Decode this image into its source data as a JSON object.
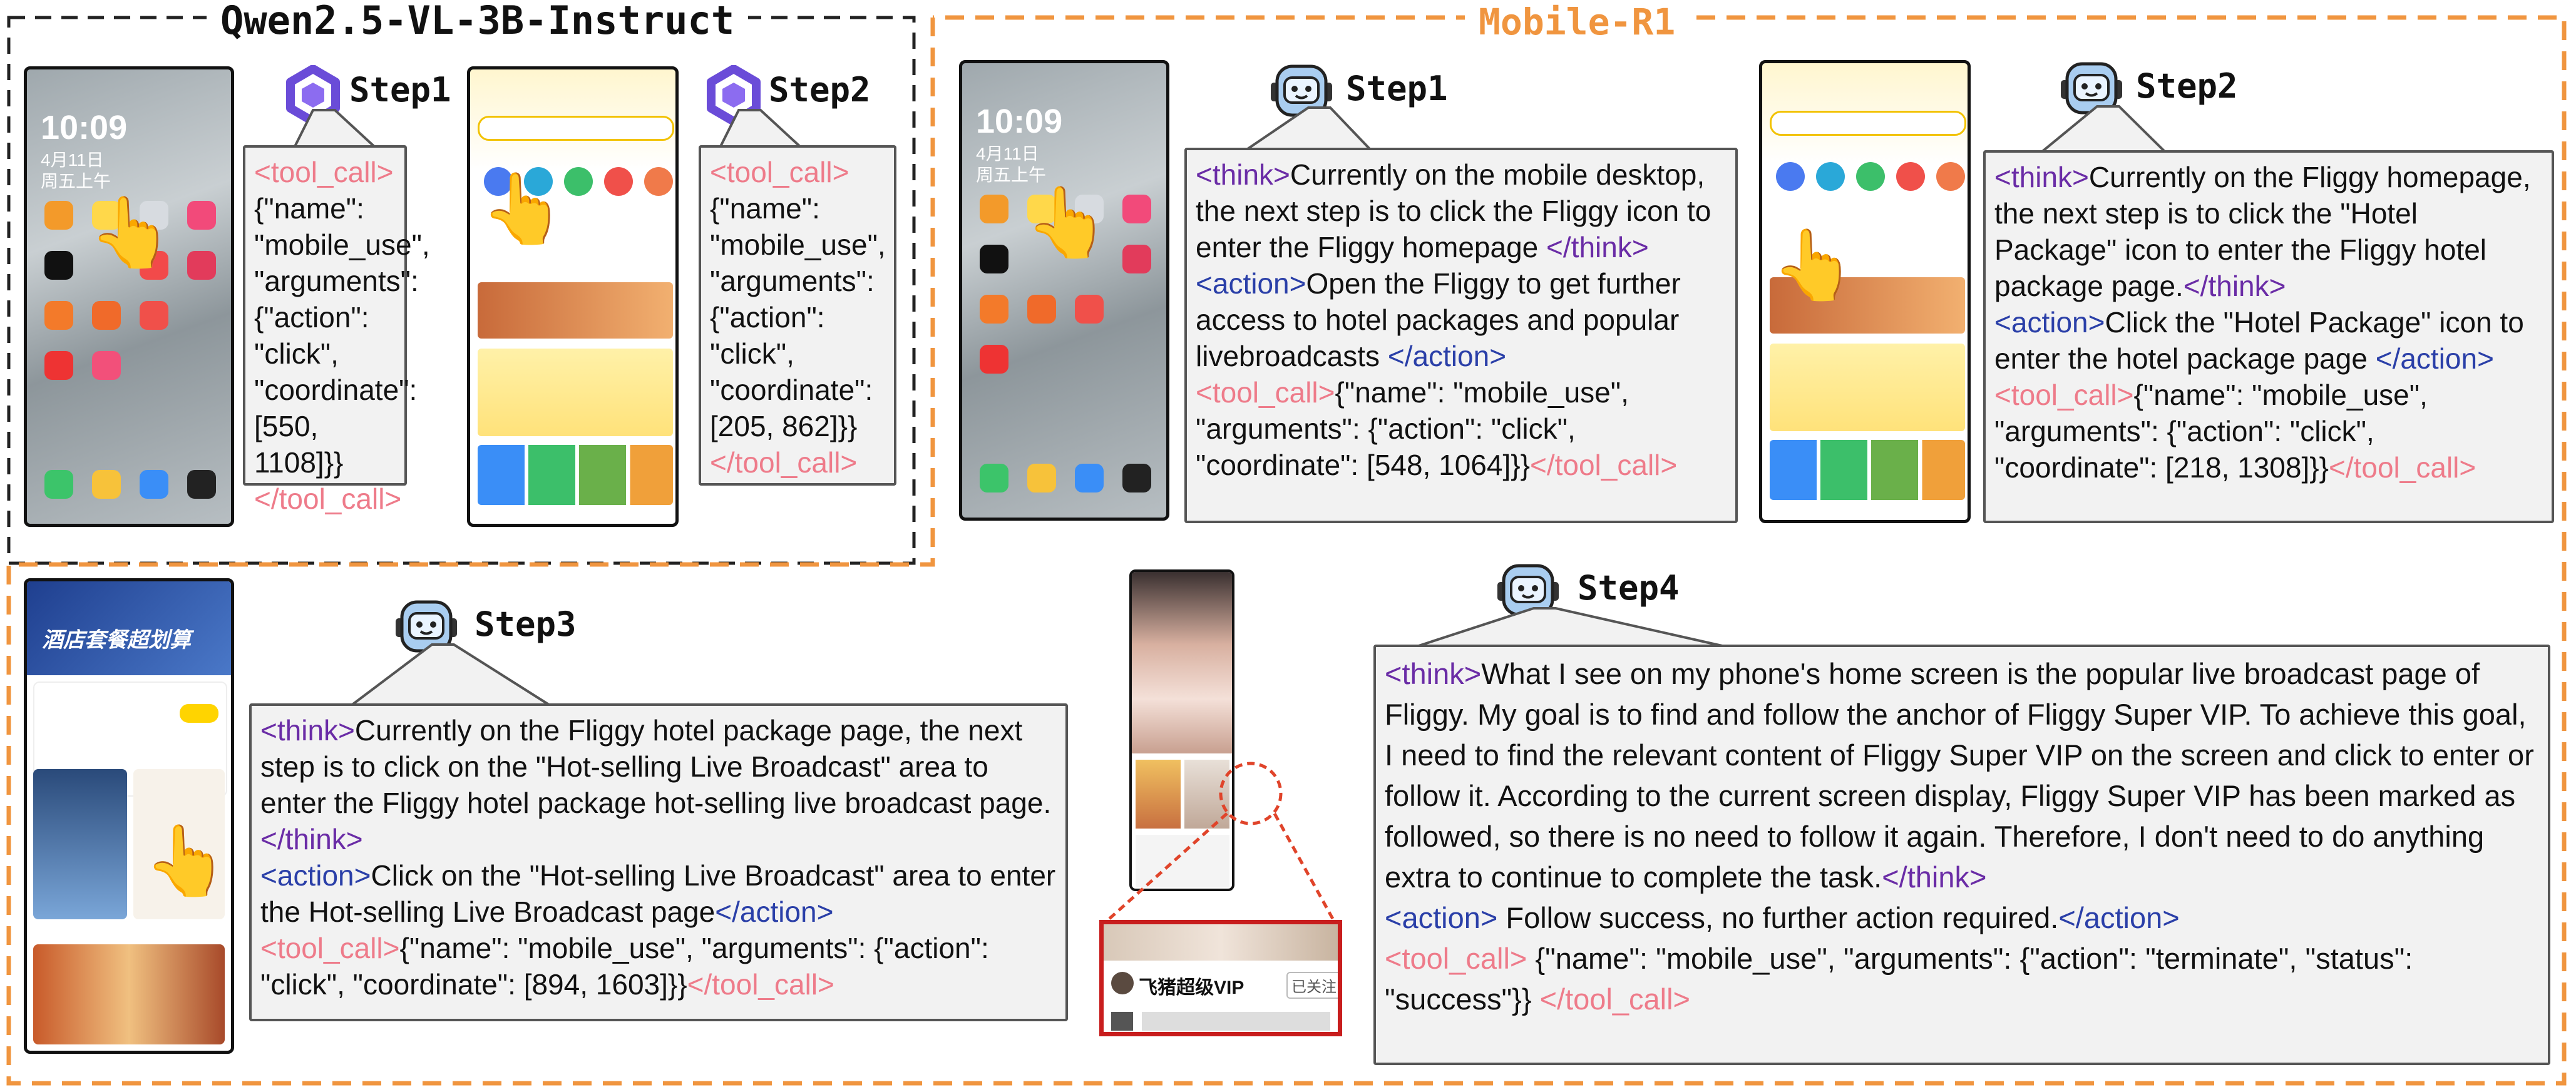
{
  "panels": {
    "left_title": "Qwen2.5-VL-3B-Instruct",
    "right_title": "Mobile-R1"
  },
  "qwen": {
    "step1": {
      "label": "Step1",
      "tool_open": "<tool_call>",
      "body": "{\"name\": \"mobile_use\", \"arguments\": {\"action\": \"click\", \"coordinate\": [550, 1108]}}",
      "tool_close": "</tool_call>"
    },
    "step2": {
      "label": "Step2",
      "tool_open": "<tool_call>",
      "body": "{\"name\": \"mobile_use\", \"arguments\": {\"action\": \"click\", \"coordinate\": [205, 862]}}",
      "tool_close": "</tool_call>"
    }
  },
  "mobile_r1": {
    "step1": {
      "label": "Step1",
      "think_open": "<think>",
      "think": "Currently on the mobile desktop, the next step is to click the Fliggy icon to enter the Fliggy homepage ",
      "think_close": "</think>",
      "action_open": "<action>",
      "action": "Open the Fliggy to get further access to hotel packages and popular livebroadcasts ",
      "action_close": "</action>",
      "tool_open": "<tool_call>",
      "tool": "{\"name\": \"mobile_use\", \"arguments\": {\"action\": \"click\", \"coordinate\": [548, 1064]}}",
      "tool_close": "</tool_call>"
    },
    "step2": {
      "label": "Step2",
      "think_open": "<think>",
      "think": "Currently on the Fliggy homepage, the next step is to click the \"Hotel Package\" icon to enter the Fliggy hotel package page.",
      "think_close": "</think>",
      "action_open": "<action>",
      "action": "Click the \"Hotel Package\" icon to enter the hotel package page ",
      "action_close": "</action>",
      "tool_open": "<tool_call>",
      "tool": "{\"name\": \"mobile_use\", \"arguments\": {\"action\": \"click\", \"coordinate\": [218, 1308]}}",
      "tool_close": "</tool_call>"
    },
    "step3": {
      "label": "Step3",
      "think_open": "<think>",
      "think": "Currently on the Fliggy hotel package page, the next step is to click on the \"Hot-selling Live Broadcast\" area to enter the Fliggy hotel package hot-selling live broadcast page.",
      "think_close": "</think>",
      "action_open": "<action>",
      "action": "Click on the \"Hot-selling Live Broadcast\" area to enter the Hot-selling Live Broadcast page",
      "action_close": "</action>",
      "tool_open": "<tool_call>",
      "tool": "{\"name\": \"mobile_use\", \"arguments\": {\"action\": \"click\", \"coordinate\": [894, 1603]}}",
      "tool_close": "</tool_call>"
    },
    "step4": {
      "label": "Step4",
      "think_open": "<think>",
      "think": "What I see on my phone's home screen is the popular live broadcast page of Fliggy. My goal is to find and follow the anchor of Fliggy Super VIP. To achieve this goal, I need to find the relevant content of Fliggy Super VIP on the screen and click to enter or follow it. According to the current screen display, Fliggy Super VIP has been marked as followed, so there is no need to follow it again. Therefore, I don't need to do anything extra to continue to complete the task.",
      "think_close": "</think>",
      "action_open": "<action>",
      "action": " Follow success, no further action required.",
      "action_close": "</action>",
      "tool_open": "<tool_call>",
      "tool": " {\"name\": \"mobile_use\", \"arguments\": {\"action\": \"terminate\", \"status\": \"success\"}} ",
      "tool_close": "</tool_call>"
    }
  },
  "phone": {
    "time": "10:09",
    "date_line1": "4月11日",
    "date_line2": "周五上午",
    "hotel_banner": "酒店套餐超划算",
    "zoom_name": "飞猪超级VIP",
    "zoom_badge": "已关注"
  },
  "colors": {
    "qwen_border": "#222222",
    "r1_border": "#f0953f",
    "r1_title": "#f0953f",
    "think_tag": "#6a2ca6",
    "action_tag": "#2a3fa8",
    "tool_tag": "#ee7b8a",
    "zoom_box": "#c81d1d"
  },
  "icons": [
    "qwen-logo-icon",
    "robot-head-icon",
    "pointing-hand-icon"
  ]
}
